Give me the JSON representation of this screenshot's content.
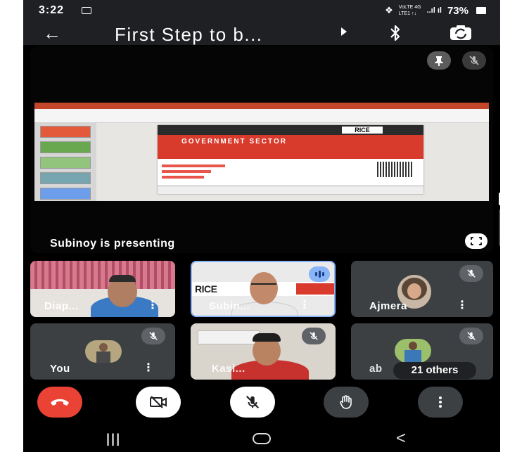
{
  "status_bar": {
    "time": "3:22",
    "network_top": "VoLTE 4G",
    "network_bottom": "LTE1 ↑↓",
    "signal": "..ıl ıl",
    "battery": "73%"
  },
  "header": {
    "title": "First  Step to b...",
    "icons": [
      "back-icon",
      "bluetooth-icon",
      "switch-camera-icon"
    ]
  },
  "presentation": {
    "presenter_label": "Subinoy is presenting",
    "slide": {
      "brand": "RICE",
      "banner": "GOVERNMENT SECTOR"
    }
  },
  "participants": [
    {
      "name": "Diap...",
      "muted": false
    },
    {
      "name": "Subin...",
      "muted": false,
      "speaking": true
    },
    {
      "name": "Ajmera",
      "muted": true
    },
    {
      "name": "You",
      "muted": true
    },
    {
      "name": "Kasi...",
      "muted": true
    },
    {
      "name": "ab",
      "muted": true,
      "others": "21 others"
    }
  ],
  "controls": [
    "end-call",
    "camera-off",
    "mic-off",
    "raise-hand",
    "more-options"
  ],
  "colors": {
    "end_call": "#ea4335",
    "tile_bg": "#3c4043",
    "speaking": "#8ab4f8"
  }
}
